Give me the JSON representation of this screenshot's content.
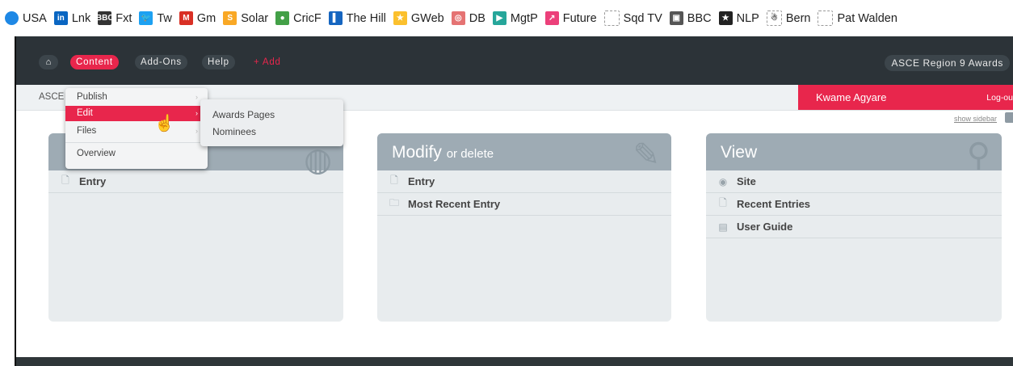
{
  "bookmarks": [
    {
      "label": "USA",
      "icon": "globe-icon",
      "color": "#1e88e5"
    },
    {
      "label": "Lnk",
      "icon": "linkedin-icon",
      "color": "#0a66c2",
      "glyph": "in"
    },
    {
      "label": "Fxt",
      "icon": "bbc-icon",
      "color": "#333333",
      "glyph": "BBC"
    },
    {
      "label": "Tw",
      "icon": "twitter-icon",
      "color": "#1da1f2",
      "glyph": "🐦"
    },
    {
      "label": "Gm",
      "icon": "gmail-icon",
      "color": "#d93025",
      "glyph": "M"
    },
    {
      "label": "Solar",
      "icon": "solar-icon",
      "color": "#f9a825",
      "glyph": "S"
    },
    {
      "label": "CricF",
      "icon": "cricket-icon",
      "color": "#43a047",
      "glyph": "●"
    },
    {
      "label": "The Hill",
      "icon": "thehill-icon",
      "color": "#1565c0",
      "glyph": "▌"
    },
    {
      "label": "GWeb",
      "icon": "flag-icon",
      "color": "#fbc02d",
      "glyph": "★"
    },
    {
      "label": "DB",
      "icon": "db-icon",
      "color": "#e57373",
      "glyph": "◎"
    },
    {
      "label": "MgtP",
      "icon": "mgtp-icon",
      "color": "#26a69a",
      "glyph": "▶"
    },
    {
      "label": "Future",
      "icon": "future-icon",
      "color": "#ec407a",
      "glyph": "↗"
    },
    {
      "label": "Sqd TV",
      "icon": "blank-page-icon",
      "color": "#ffffff",
      "glyph": ""
    },
    {
      "label": "BBC",
      "icon": "chat-icon",
      "color": "#555555",
      "glyph": "▣"
    },
    {
      "label": "NLP",
      "icon": "star-icon",
      "color": "#222222",
      "glyph": "★"
    },
    {
      "label": "Bern",
      "icon": "bern-icon",
      "color": "#ffffff",
      "glyph": "☃"
    },
    {
      "label": "Pat Walden",
      "icon": "blank-page-icon",
      "color": "#ffffff",
      "glyph": ""
    }
  ],
  "nav": {
    "content": "Content",
    "addons": "Add-Ons",
    "help": "Help",
    "add": "+ Add",
    "site": "ASCE Region 9 Awards"
  },
  "breadcrumb": {
    "label": "ASCE"
  },
  "user": {
    "name": "Kwame Agyare",
    "logout": "Log-ou"
  },
  "show_sidebar": "show sidebar",
  "panels": [
    {
      "title": "",
      "title_small": "",
      "rows": [
        {
          "icon": "🗋",
          "label": "Entry"
        }
      ]
    },
    {
      "title": "Modify",
      "title_small": "or delete",
      "rows": [
        {
          "icon": "🗋",
          "label": "Entry"
        },
        {
          "icon": "🗀",
          "label": "Most Recent Entry"
        }
      ]
    },
    {
      "title": "View",
      "title_small": "",
      "rows": [
        {
          "icon": "◉",
          "label": "Site"
        },
        {
          "icon": "🗋",
          "label": "Recent Entries"
        },
        {
          "icon": "▤",
          "label": "User Guide"
        }
      ]
    }
  ],
  "menu": {
    "items": [
      "Publish",
      "Edit",
      "Files",
      "Overview"
    ],
    "submenu": [
      "Awards Pages",
      "Nominees"
    ]
  },
  "colors": {
    "accent": "#e8264c",
    "nav_bg": "#2c3338",
    "panel_head": "#9eabb4"
  }
}
